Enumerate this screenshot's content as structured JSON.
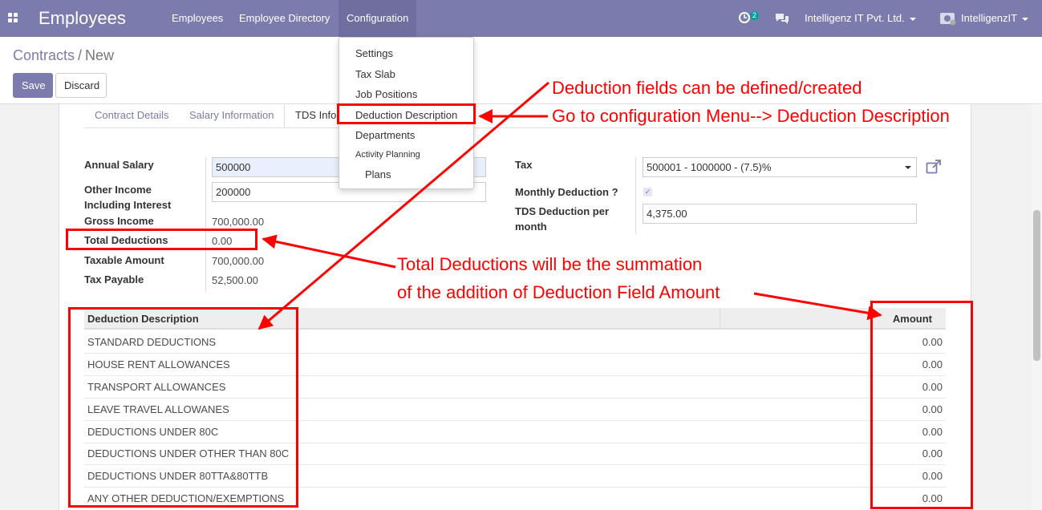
{
  "navbar": {
    "app_title": "Employees",
    "menu": [
      "Employees",
      "Employee Directory",
      "Configuration"
    ],
    "activity_count": "2",
    "company": "Intelligenz IT Pvt. Ltd.",
    "user": "IntelligenzIT"
  },
  "breadcrumb": {
    "parent": "Contracts",
    "separator": "/",
    "current": "New"
  },
  "buttons": {
    "save": "Save",
    "discard": "Discard"
  },
  "tabs": [
    "Contract Details",
    "Salary Information",
    "TDS Info"
  ],
  "config_menu": [
    "Settings",
    "Tax Slab",
    "Job Positions",
    "Deduction Description",
    "Departments",
    "Activity Planning",
    "Plans"
  ],
  "form_left": {
    "annual_salary": {
      "label": "Annual Salary",
      "value": "500000"
    },
    "other_income": {
      "label": "Other Income Including Interest",
      "value": "200000"
    },
    "gross_income": {
      "label": "Gross Income",
      "value": "700,000.00"
    },
    "total_deductions": {
      "label": "Total Deductions",
      "value": "0.00"
    },
    "taxable_amount": {
      "label": "Taxable Amount",
      "value": "700,000.00"
    },
    "tax_payable": {
      "label": "Tax Payable",
      "value": "52,500.00"
    }
  },
  "form_right": {
    "tax": {
      "label": "Tax",
      "value": "500001 - 1000000 - (7.5)%"
    },
    "monthly_deduction": {
      "label": "Monthly Deduction ?",
      "checked": true
    },
    "tds_per_month": {
      "label": "TDS Deduction per month",
      "value": "4,375.00"
    }
  },
  "deduction_table": {
    "headers": [
      "Deduction Description",
      "Amount"
    ],
    "rows": [
      [
        "STANDARD DEDUCTIONS",
        "0.00"
      ],
      [
        "HOUSE RENT ALLOWANCES",
        "0.00"
      ],
      [
        "TRANSPORT ALLOWANCES",
        "0.00"
      ],
      [
        "LEAVE TRAVEL ALLOWANES",
        "0.00"
      ],
      [
        "DEDUCTIONS UNDER 80C",
        "0.00"
      ],
      [
        "DEDUCTIONS UNDER OTHER THAN 80C",
        "0.00"
      ],
      [
        "DEDUCTIONS UNDER 80TTA&80TTB",
        "0.00"
      ],
      [
        "ANY OTHER DEDUCTION/EXEMPTIONS",
        "0.00"
      ]
    ]
  },
  "annotations": {
    "line1": "Deduction fields can be defined/created",
    "line2": "Go to configuration Menu--> Deduction Description",
    "line3": "Total Deductions will be the summation",
    "line4": "of the addition of Deduction Field Amount"
  },
  "colors": {
    "brand": "#7c7bad",
    "annotation": "#ff0000"
  }
}
